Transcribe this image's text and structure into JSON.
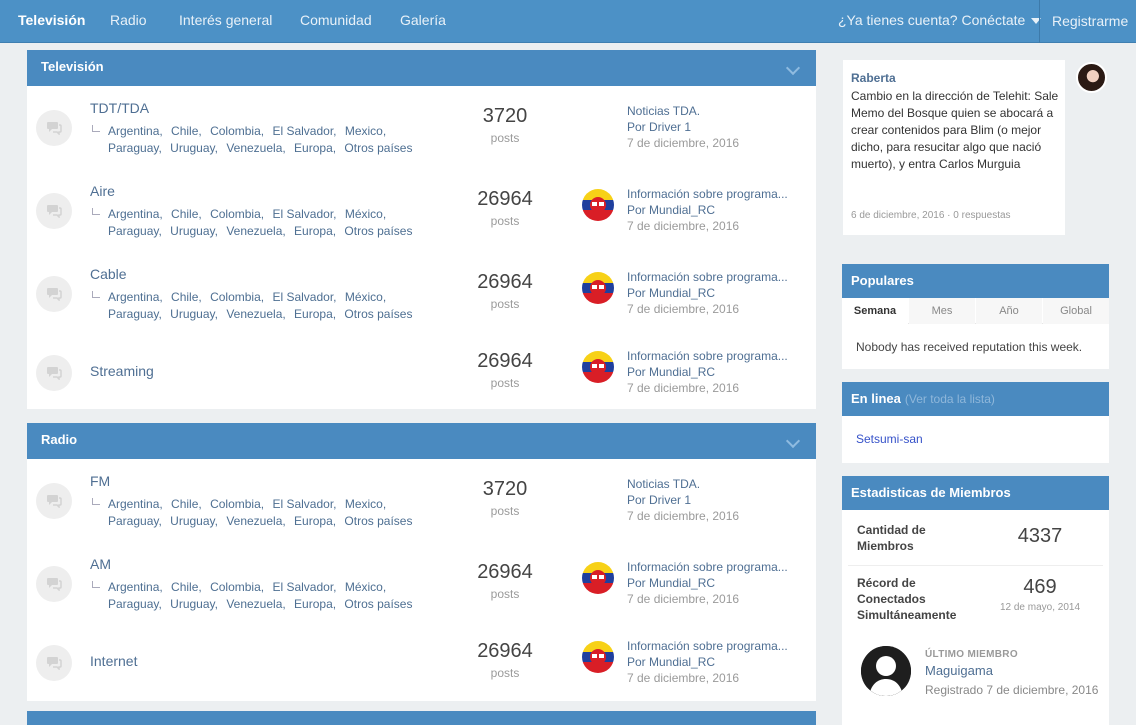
{
  "nav": {
    "tabs": [
      {
        "label": "Televisión",
        "active": true
      },
      {
        "label": "Radio"
      },
      {
        "label": "Interés general"
      },
      {
        "label": "Comunidad"
      },
      {
        "label": "Galería"
      }
    ],
    "login": "¿Ya tienes cuenta? Conéctate",
    "register": "Registrarme"
  },
  "sections": [
    {
      "title": "Televisión",
      "forums": [
        {
          "name": "TDT/TDA",
          "subforums": [
            "Argentina,",
            "Chile,",
            "Colombia,",
            "El Salvador,",
            "Mexico,",
            "Paraguay,",
            "Uruguay,",
            "Venezuela,",
            "Europa,",
            "Otros países"
          ],
          "count": "3720",
          "count_label": "posts",
          "last_title": "Noticias TDA.",
          "last_by": "Por Driver 1",
          "last_date": "7 de diciembre, 2016"
        },
        {
          "name": "Aire",
          "subforums": [
            "Argentina,",
            "Chile,",
            "Colombia,",
            "El Salvador,",
            "México,",
            "Paraguay,",
            "Uruguay,",
            "Venezuela,",
            "Europa,",
            "Otros países"
          ],
          "count": "26964",
          "count_label": "posts",
          "last_title": "Información sobre programa...",
          "last_by": "Por Mundial_RC",
          "last_date": "7 de diciembre, 2016"
        },
        {
          "name": "Cable",
          "subforums": [
            "Argentina,",
            "Chile,",
            "Colombia,",
            "El Salvador,",
            "México,",
            "Paraguay,",
            "Uruguay,",
            "Venezuela,",
            "Europa,",
            "Otros países"
          ],
          "count": "26964",
          "count_label": "posts",
          "last_title": "Información sobre programa...",
          "last_by": "Por Mundial_RC",
          "last_date": "7 de diciembre, 2016"
        },
        {
          "name": "Streaming",
          "subforums": [],
          "count": "26964",
          "count_label": "posts",
          "last_title": "Información sobre programa...",
          "last_by": "Por Mundial_RC",
          "last_date": "7 de diciembre, 2016"
        }
      ]
    },
    {
      "title": "Radio",
      "forums": [
        {
          "name": "FM",
          "subforums": [
            "Argentina,",
            "Chile,",
            "Colombia,",
            "El Salvador,",
            "Mexico,",
            "Paraguay,",
            "Uruguay,",
            "Venezuela,",
            "Europa,",
            "Otros países"
          ],
          "count": "3720",
          "count_label": "posts",
          "last_title": "Noticias TDA.",
          "last_by": "Por Driver 1",
          "last_date": "7 de diciembre, 2016"
        },
        {
          "name": "AM",
          "subforums": [
            "Argentina,",
            "Chile,",
            "Colombia,",
            "El Salvador,",
            "México,",
            "Paraguay,",
            "Uruguay,",
            "Venezuela,",
            "Europa,",
            "Otros países"
          ],
          "count": "26964",
          "count_label": "posts",
          "last_title": "Información sobre programa...",
          "last_by": "Por Mundial_RC",
          "last_date": "7 de diciembre, 2016"
        },
        {
          "name": "Internet",
          "subforums": [],
          "count": "26964",
          "count_label": "posts",
          "last_title": "Información sobre programa...",
          "last_by": "Por Mundial_RC",
          "last_date": "7 de diciembre, 2016"
        }
      ]
    }
  ],
  "sidebar": {
    "news": {
      "author": "Raberta",
      "text": "Cambio en la dirección de Telehit: Sale Memo del Bosque quien se abocará a crear contenidos para Blim (o mejor dicho, para resucitar algo que nació muerto), y entra Carlos Murguia",
      "meta": "6 de diciembre, 2016 · 0 respuestas"
    },
    "popular": {
      "title": "Populares",
      "tabs": [
        "Semana",
        "Mes",
        "Año",
        "Global"
      ],
      "empty": "Nobody has received reputation this week."
    },
    "online": {
      "title": "En linea",
      "link": "(Ver toda la lista)",
      "user": "Setsumi-san"
    },
    "stats": {
      "title": "Estadisticas de Miembros",
      "members_label": "Cantidad de Miembros",
      "members_value": "4337",
      "record_label": "Récord de Conectados Simultáneamente",
      "record_value": "469",
      "record_date": "12 de mayo, 2014",
      "last_label": "ÚLTIMO MIEMBRO",
      "last_name": "Maguigama",
      "last_date": "Registrado 7 de diciembre, 2016"
    }
  },
  "colors": {
    "nav": "#4c91c6",
    "section_header": "#4a8ac0",
    "link": "#4f6f93",
    "background": "#eceff1"
  }
}
